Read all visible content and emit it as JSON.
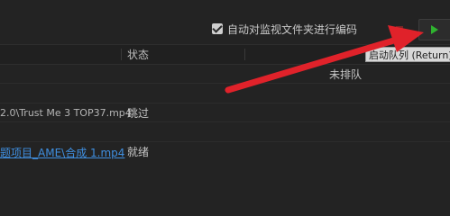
{
  "toolbar": {
    "auto_encode_label": "自动对监视文件夹进行编码",
    "auto_encode_checked": true,
    "stop_icon": "stop-square-icon",
    "play_icon": "play-triangle-icon"
  },
  "tooltip": {
    "text": "启动队列 (Return)"
  },
  "columns": {
    "status_header": "状态"
  },
  "rows": [
    {
      "path": "",
      "status": "未排队"
    },
    {
      "path": "",
      "status": ""
    },
    {
      "path": "2.0\\Trust Me 3 TOP37.mp4",
      "status": "跳过"
    },
    {
      "path": "",
      "status": ""
    },
    {
      "path": "题项目_AME\\合成 1.mp4",
      "status": "就绪"
    }
  ],
  "colors": {
    "background": "#232323",
    "link": "#3f8fe0",
    "play": "#2fb32f",
    "stop": "#7a2626",
    "annotation_arrow": "#e0222a"
  }
}
